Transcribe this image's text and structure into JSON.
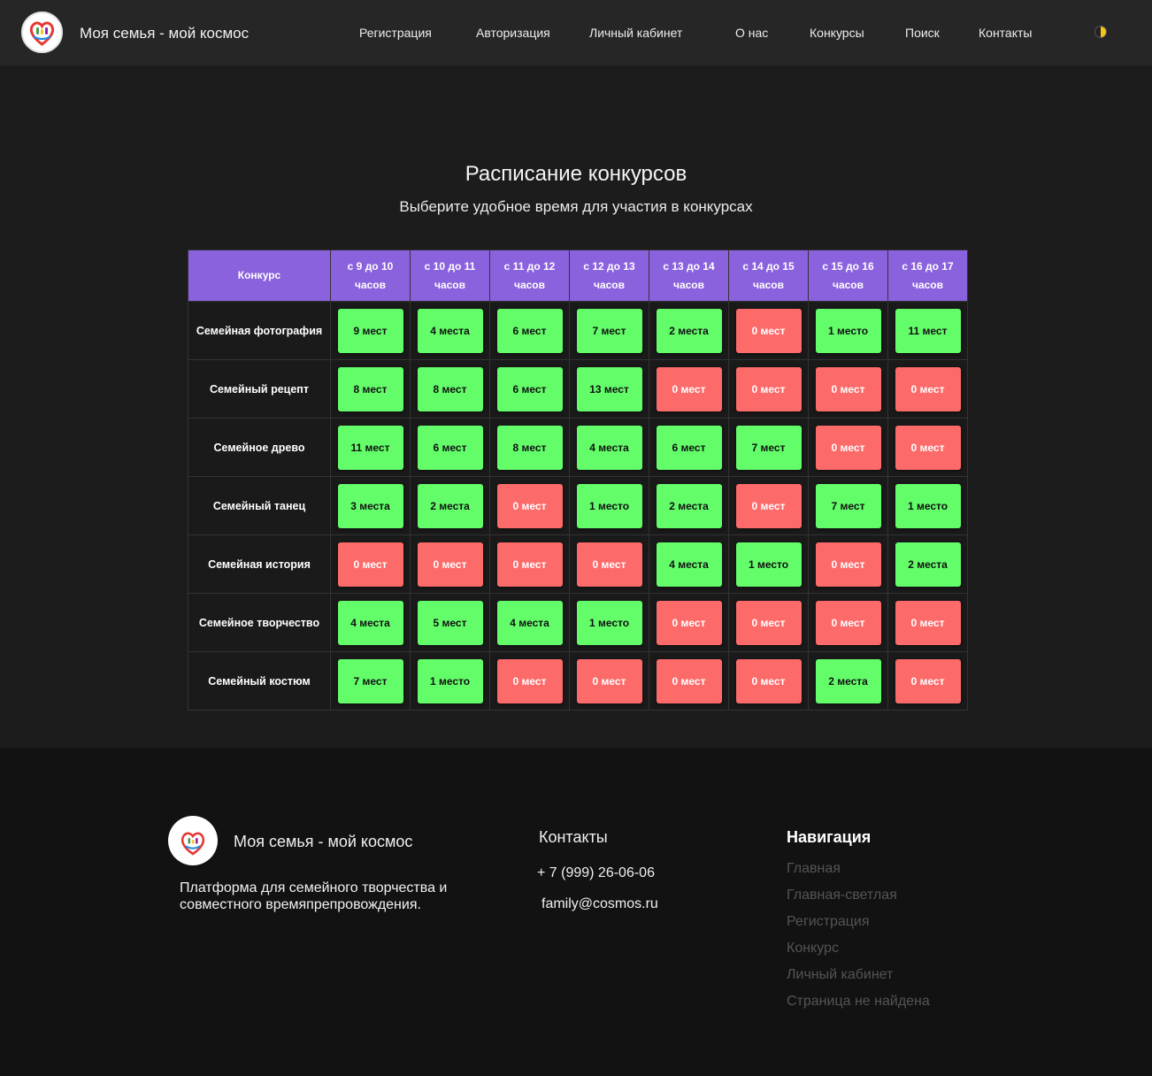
{
  "header": {
    "brand": "Моя семья - мой космос",
    "nav": [
      "Регистрация",
      "Авторизация",
      "Личный кабинет",
      "О нас",
      "Конкурсы",
      "Поиск",
      "Контакты"
    ]
  },
  "main": {
    "title": "Расписание конкурсов",
    "subtitle": "Выберите удобное время для участия в конкурсах"
  },
  "table": {
    "corner": "Конкурс",
    "slots": [
      [
        "с 9 до 10",
        "часов"
      ],
      [
        "с 10 до 11",
        "часов"
      ],
      [
        "с 11 до 12",
        "часов"
      ],
      [
        "с 12 до 13",
        "часов"
      ],
      [
        "с 13 до 14",
        "часов"
      ],
      [
        "с 14 до 15",
        "часов"
      ],
      [
        "с 15 до 16",
        "часов"
      ],
      [
        "с 16 до 17",
        "часов"
      ]
    ],
    "rows": [
      {
        "name": "Семейная фотография",
        "cells": [
          "9 мест",
          "4 места",
          "6 мест",
          "7 мест",
          "2 места",
          "0 мест",
          "1 место",
          "11 мест"
        ]
      },
      {
        "name": "Семейный рецепт",
        "cells": [
          "8 мест",
          "8 мест",
          "6 мест",
          "13 мест",
          "0 мест",
          "0 мест",
          "0 мест",
          "0 мест"
        ]
      },
      {
        "name": "Семейное древо",
        "cells": [
          "11 мест",
          "6 мест",
          "8 мест",
          "4 места",
          "6 мест",
          "7 мест",
          "0 мест",
          "0 мест"
        ]
      },
      {
        "name": "Семейный танец",
        "cells": [
          "3 места",
          "2 места",
          "0 мест",
          "1 место",
          "2 места",
          "0 мест",
          "7 мест",
          "1 место"
        ]
      },
      {
        "name": "Семейная история",
        "cells": [
          "0 мест",
          "0 мест",
          "0 мест",
          "0 мест",
          "4 места",
          "1 место",
          "0 мест",
          "2 места"
        ]
      },
      {
        "name": "Семейное творчество",
        "cells": [
          "4 места",
          "5 мест",
          "4 места",
          "1 место",
          "0 мест",
          "0 мест",
          "0 мест",
          "0 мест"
        ]
      },
      {
        "name": "Семейный костюм",
        "cells": [
          "7 мест",
          "1 место",
          "0 мест",
          "0 мест",
          "0 мест",
          "0 мест",
          "2 места",
          "0 мест"
        ]
      }
    ]
  },
  "footer": {
    "brand": "Моя семья - мой космос",
    "description": "Платформа для семейного творчества и совместного времяпрепровождения.",
    "contacts_title": "Контакты",
    "phone": "+ 7 (999) 26-06-06",
    "email": "family@cosmos.ru",
    "nav_title": "Навигация",
    "nav": [
      "Главная",
      "Главная-светлая",
      "Регистрация",
      "Конкурс",
      "Личный кабинет",
      "Страница не найдена"
    ]
  },
  "colors": {
    "header_bg": "#262626",
    "page_bg": "#1c1c1c",
    "footer_bg": "#121212",
    "table_header": "#8a62de",
    "slot_available": "#63fd6a",
    "slot_full": "#fd6a6a"
  },
  "icons": [
    "family-heart-logo-icon",
    "theme-toggle-icon"
  ]
}
